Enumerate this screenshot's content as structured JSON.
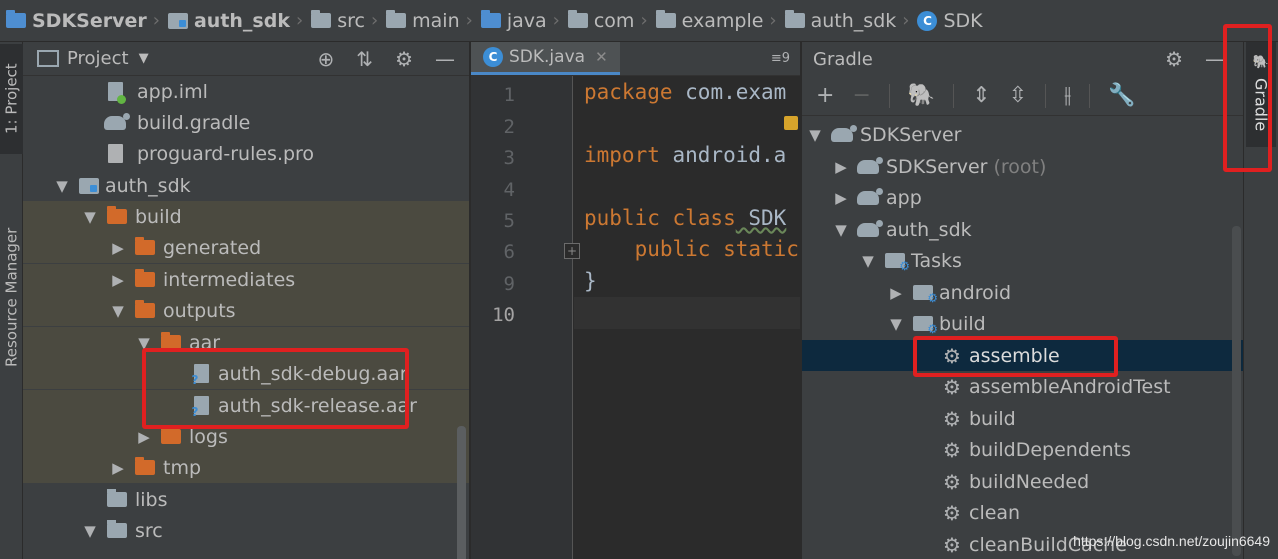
{
  "breadcrumb": [
    {
      "label": "SDKServer",
      "icon": "project-icon",
      "bold": true
    },
    {
      "label": "auth_sdk",
      "icon": "module-icon",
      "bold": true
    },
    {
      "label": "src",
      "icon": "folder-icon"
    },
    {
      "label": "main",
      "icon": "folder-icon"
    },
    {
      "label": "java",
      "icon": "source-folder-icon"
    },
    {
      "label": "com",
      "icon": "package-icon"
    },
    {
      "label": "example",
      "icon": "package-icon"
    },
    {
      "label": "auth_sdk",
      "icon": "package-icon"
    },
    {
      "label": "SDK",
      "icon": "class-icon"
    }
  ],
  "left_stripe": {
    "project_tab": "1: Project",
    "resource_tab": "Resource Manager"
  },
  "project_panel": {
    "title": "Project",
    "tree": [
      {
        "label": "app.iml",
        "icon": "iml-file-icon",
        "expanded": null
      },
      {
        "label": "build.gradle",
        "icon": "gradle-file-icon",
        "expanded": null
      },
      {
        "label": "proguard-rules.pro",
        "icon": "text-file-icon",
        "expanded": null
      },
      {
        "label": "auth_sdk",
        "icon": "module-folder-icon",
        "expanded": true
      },
      {
        "label": "build",
        "icon": "excluded-folder-icon",
        "expanded": true
      },
      {
        "label": "generated",
        "icon": "excluded-folder-icon",
        "expanded": false
      },
      {
        "label": "intermediates",
        "icon": "excluded-folder-icon",
        "expanded": false
      },
      {
        "label": "outputs",
        "icon": "excluded-folder-icon",
        "expanded": true
      },
      {
        "label": "aar",
        "icon": "excluded-folder-icon",
        "expanded": true
      },
      {
        "label": "auth_sdk-debug.aar",
        "icon": "aar-file-icon",
        "expanded": null
      },
      {
        "label": "auth_sdk-release.aar",
        "icon": "aar-file-icon",
        "expanded": null
      },
      {
        "label": "logs",
        "icon": "excluded-folder-icon",
        "expanded": false
      },
      {
        "label": "tmp",
        "icon": "excluded-folder-icon",
        "expanded": false
      },
      {
        "label": "libs",
        "icon": "folder-icon",
        "expanded": null
      },
      {
        "label": "src",
        "icon": "folder-icon",
        "expanded": true
      }
    ]
  },
  "editor": {
    "tab_label": "SDK.java",
    "tab_menu": "≡9",
    "line_numbers": [
      "1",
      "2",
      "3",
      "4",
      "5",
      "6",
      "9",
      "10"
    ],
    "lines": [
      {
        "kw": "package",
        "rest": " com.exam"
      },
      {
        "kw": "",
        "rest": ""
      },
      {
        "kw": "import",
        "rest": " android.a"
      },
      {
        "kw": "",
        "rest": ""
      },
      {
        "kw": "public class",
        "rest": " SDK"
      },
      {
        "kw": "    public static",
        "rest": ""
      },
      {
        "kw": "",
        "rest": "}"
      },
      {
        "kw": "",
        "rest": ""
      }
    ]
  },
  "gradle_panel": {
    "title": "Gradle",
    "tree": [
      {
        "label": "SDKServer",
        "note": "",
        "icon": "gradle-project-icon",
        "expanded": true
      },
      {
        "label": "SDKServer",
        "note": "(root)",
        "icon": "gradle-project-icon",
        "expanded": false
      },
      {
        "label": "app",
        "note": "",
        "icon": "gradle-project-icon",
        "expanded": false
      },
      {
        "label": "auth_sdk",
        "note": "",
        "icon": "gradle-project-icon",
        "expanded": true
      },
      {
        "label": "Tasks",
        "note": "",
        "icon": "task-folder-icon",
        "expanded": true
      },
      {
        "label": "android",
        "note": "",
        "icon": "task-folder-icon",
        "expanded": false
      },
      {
        "label": "build",
        "note": "",
        "icon": "task-folder-icon",
        "expanded": true
      },
      {
        "label": "assemble",
        "note": "",
        "icon": "gear-icon",
        "expanded": null,
        "selected": true
      },
      {
        "label": "assembleAndroidTest",
        "note": "",
        "icon": "gear-icon",
        "expanded": null
      },
      {
        "label": "build",
        "note": "",
        "icon": "gear-icon",
        "expanded": null
      },
      {
        "label": "buildDependents",
        "note": "",
        "icon": "gear-icon",
        "expanded": null
      },
      {
        "label": "buildNeeded",
        "note": "",
        "icon": "gear-icon",
        "expanded": null
      },
      {
        "label": "clean",
        "note": "",
        "icon": "gear-icon",
        "expanded": null
      },
      {
        "label": "cleanBuildCache",
        "note": "",
        "icon": "gear-icon",
        "expanded": null
      }
    ]
  },
  "right_stripe": {
    "gradle_tab": "Gradle"
  },
  "watermark": "https://blog.csdn.net/zoujin6649",
  "colors": {
    "annotation": "#e02020",
    "selection": "#0d293e",
    "highlight_row": "#4b4a40"
  }
}
